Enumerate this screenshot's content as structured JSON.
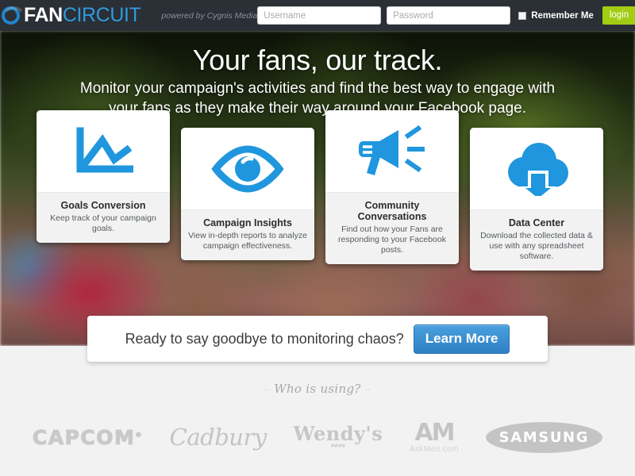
{
  "header": {
    "logo_mark": "circle-ring-icon",
    "brand_first": "FAN",
    "brand_second": "CIRCUIT",
    "powered_by": "powered by Cygnis Media",
    "brand_blue": "#2e9bdd",
    "bar_bg": "#2b2f36",
    "login": {
      "username_value": "",
      "username_placeholder": "Username",
      "password_value": "",
      "password_placeholder": "Password",
      "remember_label": "Remember Me",
      "remember_checked": false,
      "login_label": "login",
      "login_btn_color": "#a2cd14"
    }
  },
  "hero": {
    "title": "Your fans, our track.",
    "subtitle": "Monitor your campaign's activities and find the best way to engage with your fans as they make their way around your Facebook page."
  },
  "cards": [
    {
      "icon": "line-chart-icon",
      "title": "Goals Conversion",
      "desc": "Keep track of your campaign goals."
    },
    {
      "icon": "eye-icon",
      "title": "Campaign Insights",
      "desc": "View in-depth reports to analyze campaign effectiveness."
    },
    {
      "icon": "megaphone-icon",
      "title": "Community Conversations",
      "desc": "Find out how your Fans are responding to your Facebook posts."
    },
    {
      "icon": "cloud-download-icon",
      "title": "Data Center",
      "desc": "Download the collected data & use with any spreadsheet software."
    }
  ],
  "cta": {
    "text": "Ready to say goodbye to monitoring chaos?",
    "button_label": "Learn More",
    "button_color": "#2e80c4"
  },
  "footer": {
    "who_using": "Who is using?",
    "logos": [
      {
        "name": "CAPCOM",
        "mark": "®"
      },
      {
        "name": "Cadbury",
        "mark": ""
      },
      {
        "name": "Wendy's",
        "mark": ""
      },
      {
        "name": "AM",
        "mark": "AskMen.com"
      },
      {
        "name": "SAMSUNG",
        "mark": ""
      }
    ]
  },
  "icon_color": "#1f96dd"
}
